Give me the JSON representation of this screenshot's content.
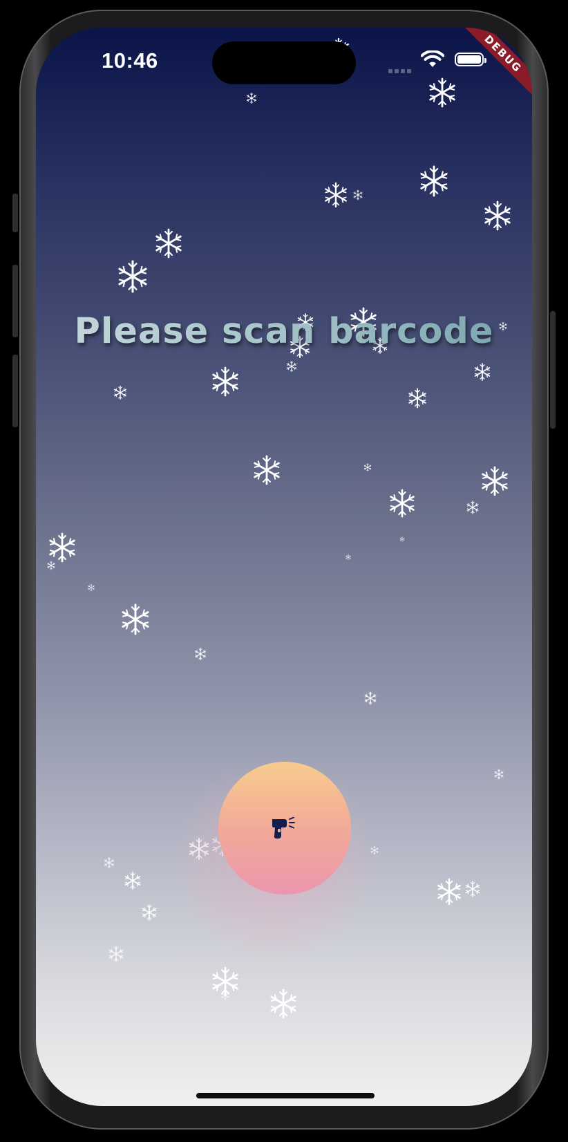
{
  "status_bar": {
    "time": "10:46",
    "wifi_icon": "wifi-icon",
    "battery_icon": "battery-icon"
  },
  "debug_banner": {
    "label": "DEBUG",
    "color": "#8c1b2a"
  },
  "main": {
    "title": "Please scan barcode",
    "scan_button": {
      "icon": "barcode-scanner-icon",
      "gradient": [
        "#f7cc8e",
        "#eb96ae"
      ]
    }
  },
  "background": {
    "gradient_top": "#0b1448",
    "gradient_bottom": "#eff0ef",
    "decoration": "snowflake-icon"
  }
}
